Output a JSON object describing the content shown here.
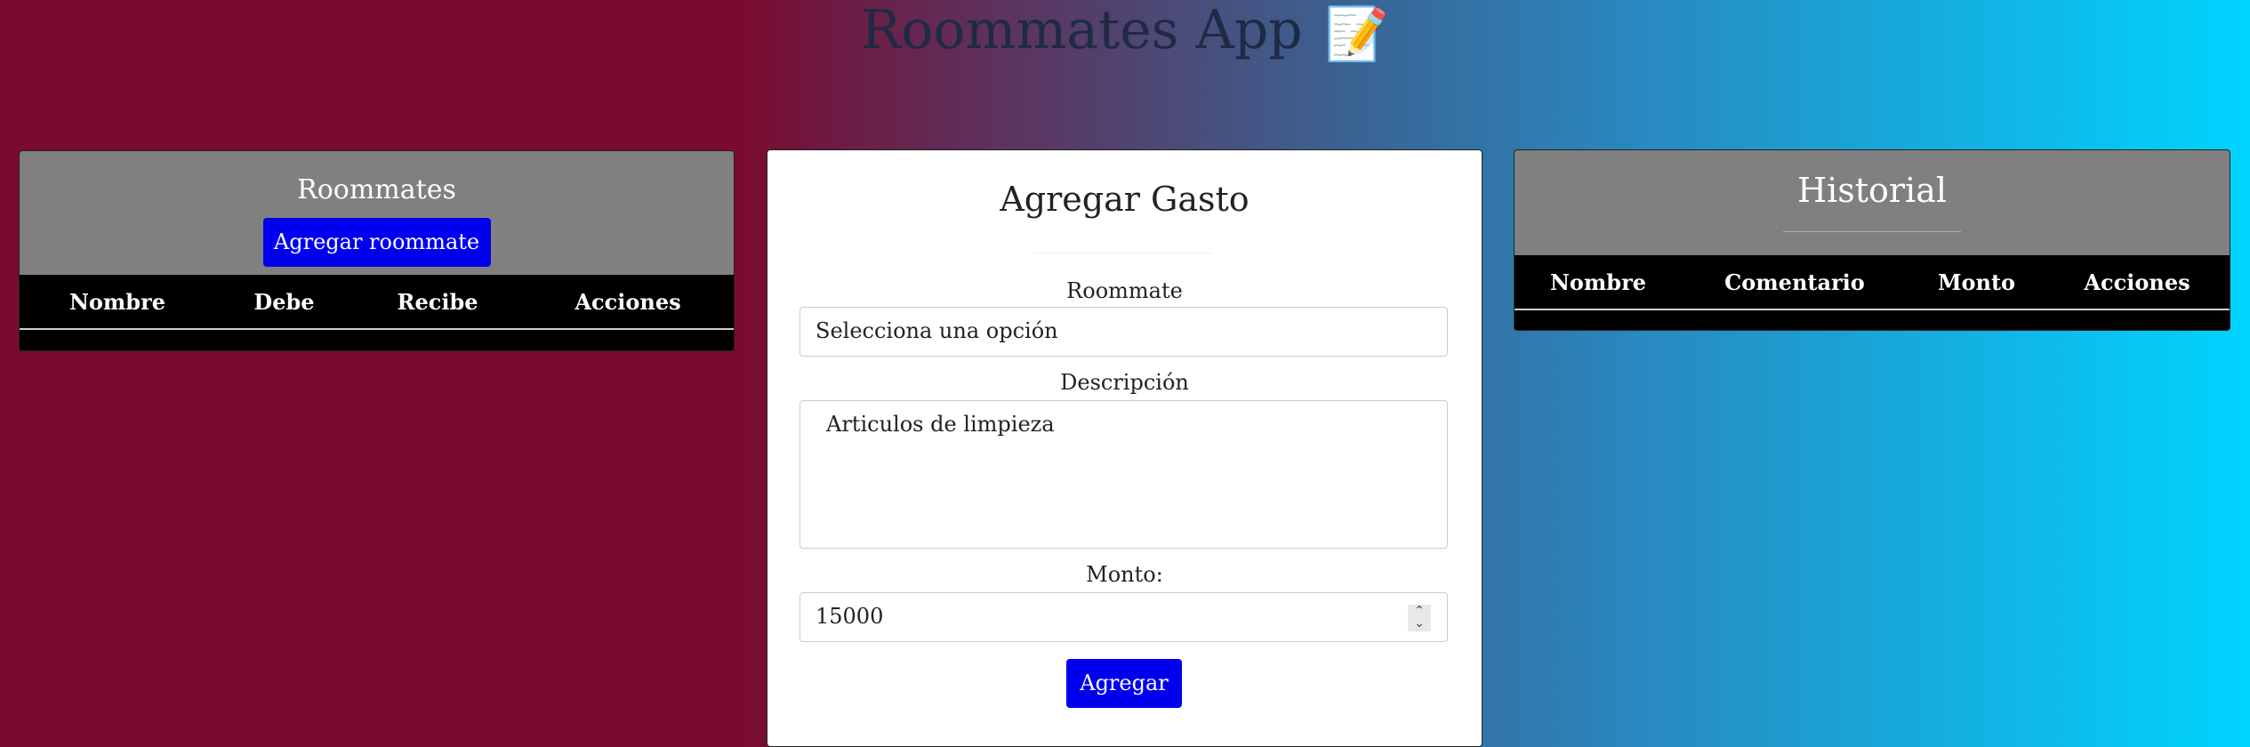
{
  "app": {
    "title": "Roommates App",
    "title_emoji": "📝"
  },
  "roommates_panel": {
    "title": "Roommates",
    "add_button": "Agregar roommate",
    "columns": [
      "Nombre",
      "Debe",
      "Recibe",
      "Acciones"
    ]
  },
  "expense_form": {
    "title": "Agregar Gasto",
    "roommate_label": "Roommate",
    "roommate_value": "Selecciona una opción",
    "description_label": "Descripción",
    "description_value": "Articulos de limpieza",
    "amount_label": "Monto:",
    "amount_value": "15000",
    "submit_button": "Agregar"
  },
  "history_panel": {
    "title": "Historial",
    "columns": [
      "Nombre",
      "Comentario",
      "Monto",
      "Acciones"
    ]
  },
  "colors": {
    "background_left": "#790b30",
    "background_right": "#00d4ff",
    "button_blue": "#0000ee",
    "panel_header_gray": "#808080"
  },
  "icons": {
    "title_icon": "memo-icon",
    "spinner_icon": "stepper-arrows-icon"
  }
}
